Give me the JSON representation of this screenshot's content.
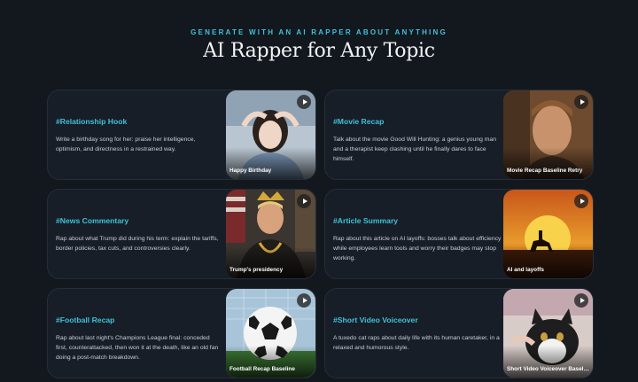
{
  "header": {
    "eyebrow": "GENERATE WITH AN AI RAPPER ABOUT ANYTHING",
    "title": "AI Rapper for Any Topic"
  },
  "cards": [
    {
      "tag": "#Relationship Hook",
      "description": "Write a birthday song for her: praise her intelligence, optimism, and directness in a restrained way.",
      "thumb_label": "Happy Birthday"
    },
    {
      "tag": "#Movie Recap",
      "description": "Talk about the movie Good Will Hunting: a genius young man and a therapist keep clashing until he finally dares to face himself.",
      "thumb_label": "Movie Recap Baseline Retry"
    },
    {
      "tag": "#News Commentary",
      "description": "Rap about what Trump did during his term: explain the tariffs, border policies, tax cuts, and controversies clearly.",
      "thumb_label": "Trump's presidency"
    },
    {
      "tag": "#Article Summary",
      "description": "Rap about this article on AI layoffs: bosses talk about efficiency while employees learn tools and worry their badges may stop working.",
      "thumb_label": "AI and layoffs"
    },
    {
      "tag": "#Football Recap",
      "description": "Rap about last night's Champions League final: conceded first, counterattacked, then won it at the death, like an old fan doing a post-match breakdown.",
      "thumb_label": "Football Recap Baseline"
    },
    {
      "tag": "#Short Video Voiceover",
      "description": "A tuxedo cat raps about daily life with its human caretaker, in a relaxed and humorous style.",
      "thumb_label": "Short Video Voiceover Baseline"
    }
  ],
  "icons": {
    "play": "play-icon"
  },
  "colors": {
    "accent": "#3fc1d9",
    "background": "#13181f",
    "card": "#181e27"
  }
}
